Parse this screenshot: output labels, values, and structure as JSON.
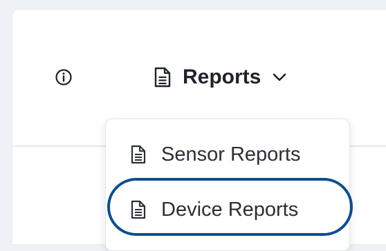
{
  "header": {
    "info_icon": "info-circle-icon",
    "reports_menu": {
      "label": "Reports",
      "icon": "document-icon",
      "chevron": "chevron-down-icon"
    }
  },
  "dropdown": {
    "items": [
      {
        "label": "Sensor Reports",
        "icon": "document-icon"
      },
      {
        "label": "Device Reports",
        "icon": "document-icon",
        "highlighted": true
      }
    ]
  },
  "colors": {
    "background": "#eef1f5",
    "panel": "#ffffff",
    "text": "#1f2329",
    "highlight_ring": "#0d4d8c"
  }
}
